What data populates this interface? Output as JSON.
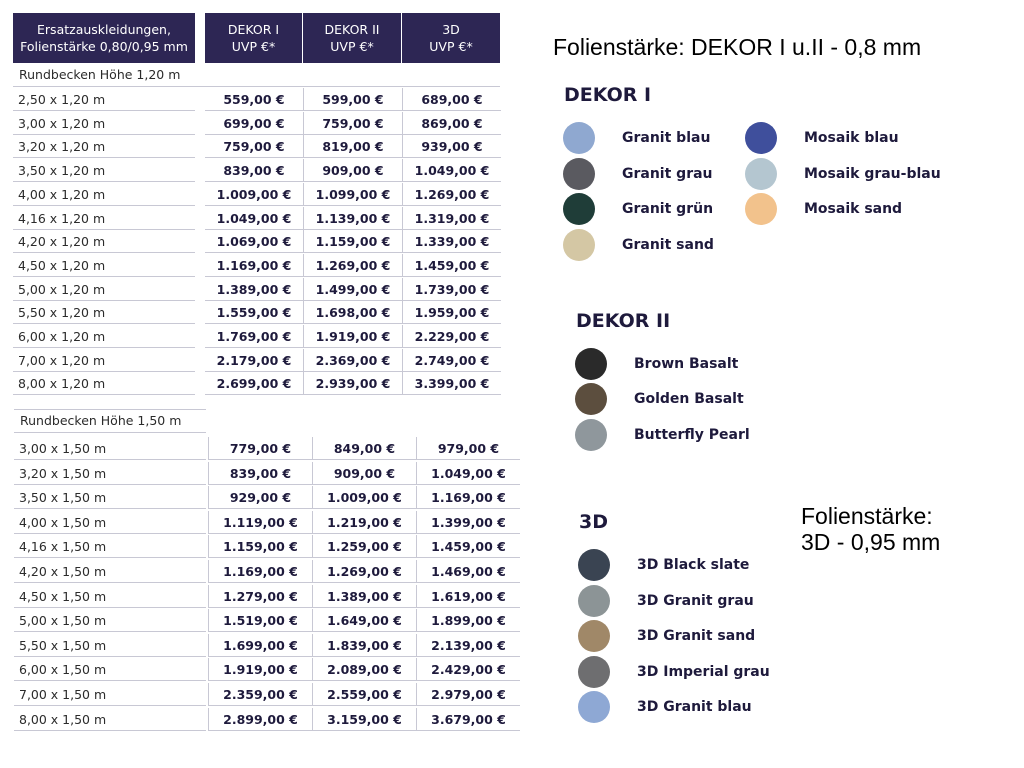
{
  "header": {
    "size_line1": "Ersatzauskleidungen,",
    "size_line2": "Folienstärke 0,80/0,95 mm",
    "col1_line1": "DEKOR I",
    "col1_line2": "UVP €*",
    "col2_line1": "DEKOR II",
    "col2_line2": "UVP €*",
    "col3_line1": "3D",
    "col3_line2": "UVP €*"
  },
  "section1": {
    "title": "Rundbecken Höhe 1,20 m",
    "rows": [
      [
        "2,50 x 1,20 m",
        "559,00 €",
        "599,00 €",
        "689,00 €"
      ],
      [
        "3,00 x 1,20 m",
        "699,00 €",
        "759,00 €",
        "869,00 €"
      ],
      [
        "3,20 x 1,20 m",
        "759,00 €",
        "819,00 €",
        "939,00 €"
      ],
      [
        "3,50 x 1,20 m",
        "839,00 €",
        "909,00 €",
        "1.049,00 €"
      ],
      [
        "4,00 x 1,20 m",
        "1.009,00 €",
        "1.099,00 €",
        "1.269,00 €"
      ],
      [
        "4,16 x 1,20 m",
        "1.049,00 €",
        "1.139,00 €",
        "1.319,00 €"
      ],
      [
        "4,20 x 1,20 m",
        "1.069,00 €",
        "1.159,00 €",
        "1.339,00 €"
      ],
      [
        "4,50 x 1,20 m",
        "1.169,00 €",
        "1.269,00 €",
        "1.459,00 €"
      ],
      [
        "5,00 x 1,20 m",
        "1.389,00 €",
        "1.499,00 €",
        "1.739,00 €"
      ],
      [
        "5,50 x 1,20 m",
        "1.559,00 €",
        "1.698,00 €",
        "1.959,00 €"
      ],
      [
        "6,00 x 1,20 m",
        "1.769,00 €",
        "1.919,00 €",
        "2.229,00 €"
      ],
      [
        "7,00 x 1,20 m",
        "2.179,00 €",
        "2.369,00 €",
        "2.749,00 €"
      ],
      [
        "8,00 x 1,20 m",
        "2.699,00 €",
        "2.939,00 €",
        "3.399,00 €"
      ]
    ]
  },
  "section2": {
    "title": "Rundbecken Höhe 1,50 m",
    "rows": [
      [
        "3,00 x 1,50 m",
        "779,00 €",
        "849,00 €",
        "979,00 €"
      ],
      [
        "3,20 x 1,50 m",
        "839,00 €",
        "909,00 €",
        "1.049,00 €"
      ],
      [
        "3,50 x 1,50 m",
        "929,00 €",
        "1.009,00 €",
        "1.169,00 €"
      ],
      [
        "4,00 x 1,50 m",
        "1.119,00 €",
        "1.219,00 €",
        "1.399,00 €"
      ],
      [
        "4,16 x 1,50 m",
        "1.159,00 €",
        "1.259,00 €",
        "1.459,00 €"
      ],
      [
        "4,20 x 1,50 m",
        "1.169,00 €",
        "1.269,00 €",
        "1.469,00 €"
      ],
      [
        "4,50 x 1,50 m",
        "1.279,00 €",
        "1.389,00 €",
        "1.619,00 €"
      ],
      [
        "5,00 x 1,50 m",
        "1.519,00 €",
        "1.649,00 €",
        "1.899,00 €"
      ],
      [
        "5,50 x 1,50 m",
        "1.699,00 €",
        "1.839,00 €",
        "2.139,00 €"
      ],
      [
        "6,00 x 1,50 m",
        "1.919,00 €",
        "2.089,00 €",
        "2.429,00 €"
      ],
      [
        "7,00 x 1,50 m",
        "2.359,00 €",
        "2.559,00 €",
        "2.979,00 €"
      ],
      [
        "8,00 x 1,50 m",
        "2.899,00 €",
        "3.159,00 €",
        "3.679,00 €"
      ]
    ]
  },
  "notes": {
    "note1": "Folienstärke: DEKOR I u.II -  0,8 mm",
    "note2": "Folienstärke:\n3D - 0,95 mm"
  },
  "dekor1": {
    "title": "DEKOR I",
    "swatches": [
      {
        "label": "Granit blau",
        "color": "#8fa8d0"
      },
      {
        "label": "Granit grau",
        "color": "#5a5a60"
      },
      {
        "label": "Granit grün",
        "color": "#1f3d38"
      },
      {
        "label": "Granit sand",
        "color": "#d4c7a4"
      },
      {
        "label": "Mosaik blau",
        "color": "#3f4f9c"
      },
      {
        "label": "Mosaik grau-blau",
        "color": "#b4c6d0"
      },
      {
        "label": "Mosaik sand",
        "color": "#f2c28c"
      }
    ]
  },
  "dekor2": {
    "title": "DEKOR II",
    "swatches": [
      {
        "label": "Brown Basalt",
        "color": "#2a2a2a"
      },
      {
        "label": "Golden Basalt",
        "color": "#5c4e3e"
      },
      {
        "label": "Butterfly Pearl",
        "color": "#8f979c"
      }
    ]
  },
  "d3": {
    "title": "3D",
    "swatches": [
      {
        "label": "3D Black slate",
        "color": "#3a4452"
      },
      {
        "label": "3D Granit grau",
        "color": "#8c9496"
      },
      {
        "label": "3D Granit sand",
        "color": "#a08868"
      },
      {
        "label": "3D Imperial grau",
        "color": "#6e6e70"
      },
      {
        "label": "3D Granit blau",
        "color": "#8ea8d4"
      }
    ]
  }
}
